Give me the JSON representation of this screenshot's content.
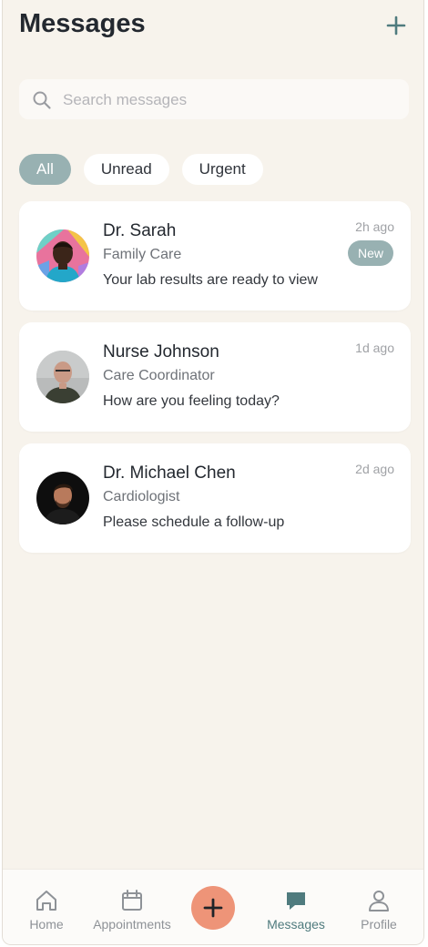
{
  "header": {
    "title": "Messages",
    "add_icon": "plus-icon"
  },
  "search": {
    "placeholder": "Search messages",
    "value": ""
  },
  "filters": [
    {
      "label": "All",
      "active": true
    },
    {
      "label": "Unread",
      "active": false
    },
    {
      "label": "Urgent",
      "active": false
    }
  ],
  "messages": [
    {
      "name": "Dr. Sarah",
      "role": "Family Care",
      "preview": "Your lab results are ready to view",
      "time": "2h ago",
      "badge": "New"
    },
    {
      "name": "Nurse Johnson",
      "role": "Care Coordinator",
      "preview": "How are you feeling today?",
      "time": "1d ago"
    },
    {
      "name": "Dr. Michael Chen",
      "role": "Cardiologist",
      "preview": "Please schedule a follow-up",
      "time": "2d ago"
    }
  ],
  "tabbar": {
    "home": "Home",
    "appointments": "Appointments",
    "messages": "Messages",
    "profile": "Profile",
    "active": "messages"
  },
  "colors": {
    "accent": "#98b1b2",
    "accent_dark": "#4f7b7e",
    "fab": "#ee9478",
    "background": "#f7f3ec"
  }
}
